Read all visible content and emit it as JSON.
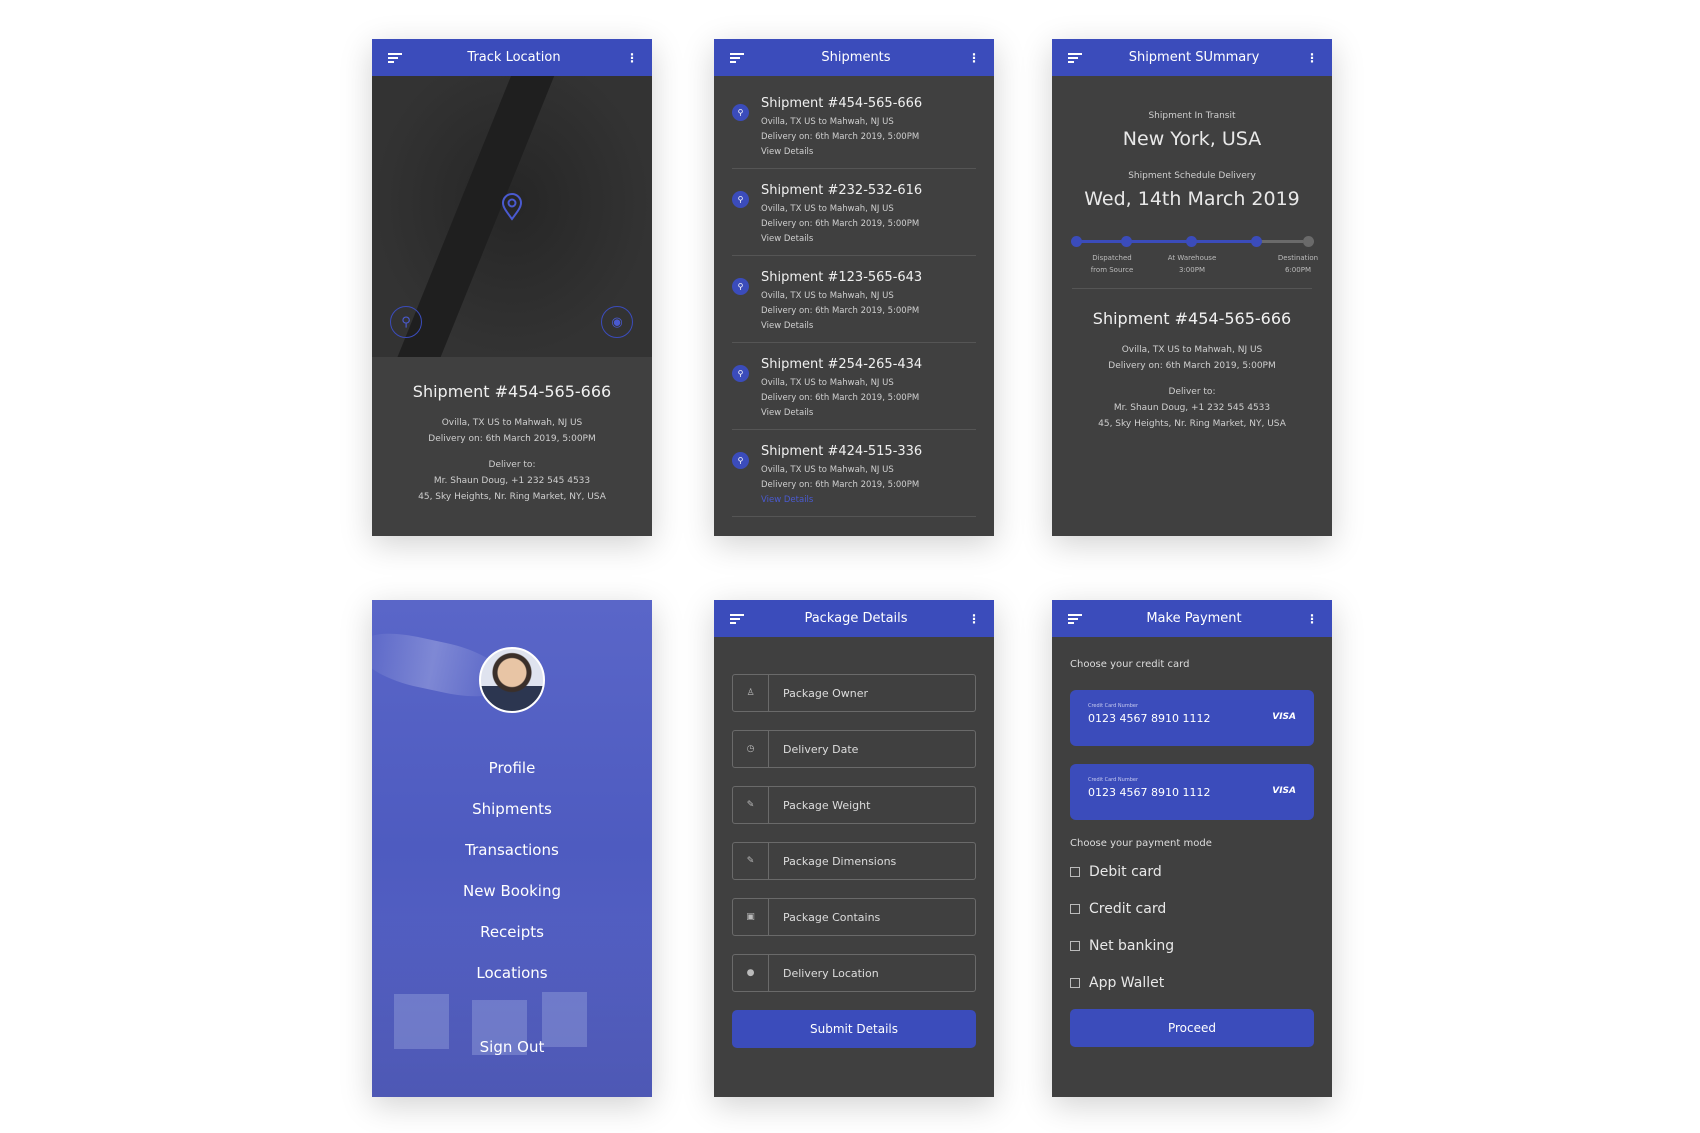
{
  "colors": {
    "accent": "#3b4cbb",
    "panel": "#404040"
  },
  "track": {
    "title": "Track Location",
    "shipment": "Shipment #454-565-666",
    "route": "Ovilla, TX US to Mahwah, NJ US",
    "delivery": "Delivery on: 6th March 2019, 5:00PM",
    "deliver_to_label": "Deliver to:",
    "recipient": "Mr. Shaun Doug, +1 232 545 4533",
    "address": "45, Sky Heights, Nr. Ring Market, NY, USA"
  },
  "shipments": {
    "title": "Shipments",
    "items": [
      {
        "title": "Shipment #454-565-666",
        "route": "Ovilla, TX US to Mahwah, NJ US",
        "delivery": "Delivery on: 6th March 2019, 5:00PM",
        "link": "View Details"
      },
      {
        "title": "Shipment #232-532-616",
        "route": "Ovilla, TX US to Mahwah, NJ US",
        "delivery": "Delivery on: 6th March 2019, 5:00PM",
        "link": "View Details"
      },
      {
        "title": "Shipment #123-565-643",
        "route": "Ovilla, TX US to Mahwah, NJ US",
        "delivery": "Delivery on: 6th March 2019, 5:00PM",
        "link": "View Details"
      },
      {
        "title": "Shipment #254-265-434",
        "route": "Ovilla, TX US to Mahwah, NJ US",
        "delivery": "Delivery on: 6th March 2019, 5:00PM",
        "link": "View Details"
      },
      {
        "title": "Shipment #424-515-336",
        "route": "Ovilla, TX US to Mahwah, NJ US",
        "delivery": "Delivery on: 6th March 2019, 5:00PM",
        "link": "View Details"
      }
    ]
  },
  "summary": {
    "title": "Shipment SUmmary",
    "transit_label": "Shipment In Transit",
    "transit_city": "New York, USA",
    "schedule_label": "Shipment Schedule Delivery",
    "schedule_date": "Wed, 14th March 2019",
    "progress_steps_completed": 4,
    "progress_steps_total": 5,
    "milestones": [
      {
        "line1": "Dispatched",
        "line2": "from Source"
      },
      {
        "line1": "At Warehouse",
        "line2": "3:00PM"
      },
      {
        "line1": "Destination",
        "line2": "6:00PM"
      }
    ],
    "shipment": "Shipment #454-565-666",
    "route": "Ovilla, TX US to Mahwah, NJ US",
    "delivery": "Delivery on: 6th March 2019, 5:00PM",
    "deliver_to_label": "Deliver to:",
    "recipient": "Mr. Shaun Doug, +1 232 545 4533",
    "address": "45, Sky Heights, Nr. Ring Market, NY, USA"
  },
  "menu": {
    "items": [
      "Profile",
      "Shipments",
      "Transactions",
      "New Booking",
      "Receipts",
      "Locations"
    ],
    "sign_out": "Sign Out"
  },
  "package": {
    "title": "Package Details",
    "fields": [
      {
        "label": "Package Owner",
        "icon": "user-icon"
      },
      {
        "label": "Delivery Date",
        "icon": "clock-icon"
      },
      {
        "label": "Package Weight",
        "icon": "pencil-icon"
      },
      {
        "label": "Package Dimensions",
        "icon": "pencil-icon"
      },
      {
        "label": "Package Contains",
        "icon": "box-icon"
      },
      {
        "label": "Delivery Location",
        "icon": "pin-icon"
      }
    ],
    "submit": "Submit Details"
  },
  "payment": {
    "title": "Make Payment",
    "card_heading": "Choose your credit card",
    "cards": [
      {
        "label": "Credit Card Number",
        "number": "0123 4567 8910 1112",
        "brand": "VISA"
      },
      {
        "label": "Credit Card Number",
        "number": "0123 4567 8910 1112",
        "brand": "VISA"
      }
    ],
    "mode_heading": "Choose your payment mode",
    "modes": [
      "Debit card",
      "Credit card",
      "Net banking",
      "App Wallet"
    ],
    "proceed": "Proceed"
  }
}
